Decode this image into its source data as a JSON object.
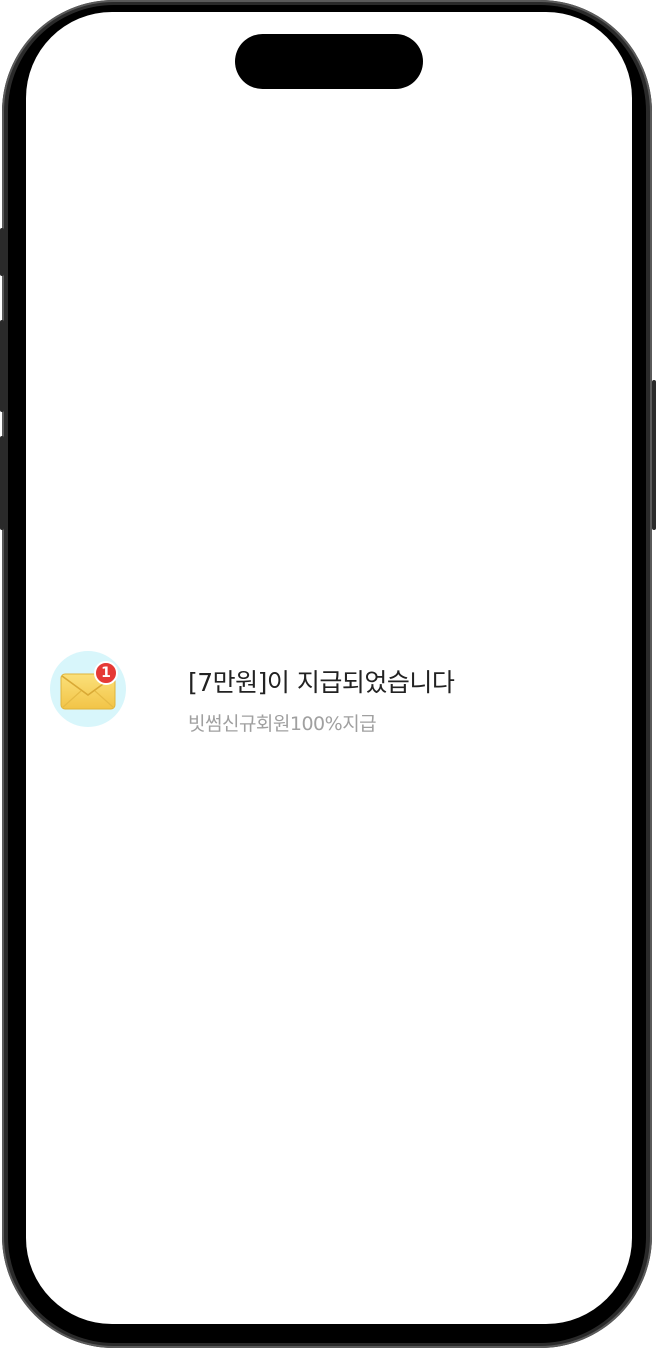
{
  "notification": {
    "title": "[7만원]이 지급되었습니다",
    "subtitle": "빗썸신규회원100%지급",
    "icon": "envelope-icon",
    "badge_count": "1",
    "colors": {
      "icon_background": "#d8f6fb",
      "envelope": "#f6cf55",
      "badge": "#e53935",
      "title": "#222222",
      "subtitle": "#a0a0a0"
    }
  }
}
